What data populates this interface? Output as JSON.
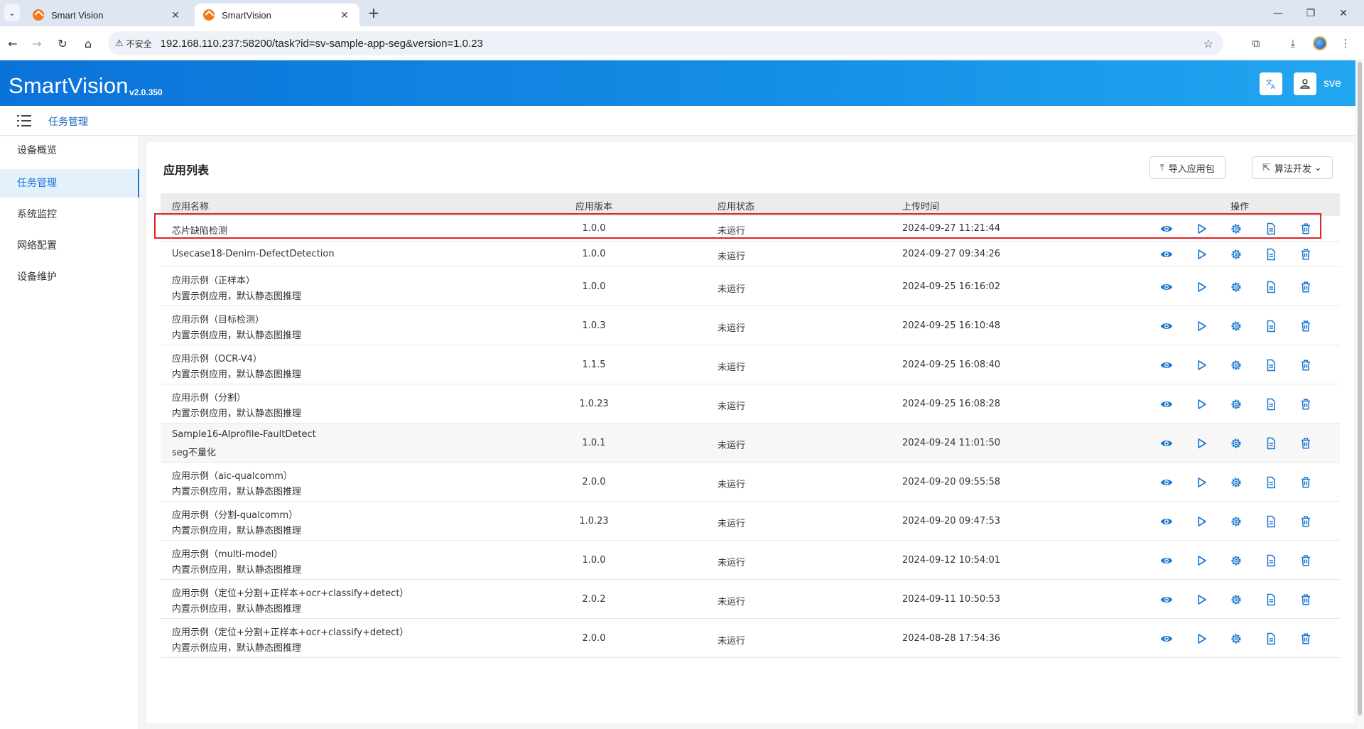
{
  "browser": {
    "tabs": [
      {
        "title": "Smart Vision",
        "active": false
      },
      {
        "title": "SmartVision",
        "active": true
      }
    ],
    "insecure_label": "不安全",
    "url": "192.168.110.237:58200/task?id=sv-sample-app-seg&version=1.0.23"
  },
  "header": {
    "brand": "SmartVision",
    "version": "v2.0.350",
    "user": "sve",
    "colors": {
      "gradient_start": "#0b72d9",
      "gradient_end": "#23a6f0"
    }
  },
  "breadcrumb": "任务管理",
  "sidebar": {
    "items": [
      {
        "label": "设备概览",
        "active": false
      },
      {
        "label": "任务管理",
        "active": true
      },
      {
        "label": "系统监控",
        "active": false
      },
      {
        "label": "网络配置",
        "active": false
      },
      {
        "label": "设备维护",
        "active": false
      }
    ]
  },
  "main": {
    "title": "应用列表",
    "import_button": "导入应用包",
    "algo_button": "算法开发",
    "columns": [
      "应用名称",
      "应用版本",
      "应用状态",
      "上传时间",
      "操作"
    ],
    "rows": [
      {
        "name": "芯片缺陷检测",
        "desc": "",
        "version": "1.0.0",
        "status": "未运行",
        "time": "2024-09-27 11:21:44"
      },
      {
        "name": "Usecase18-Denim-DefectDetection",
        "desc": "",
        "version": "1.0.0",
        "status": "未运行",
        "time": "2024-09-27 09:34:26"
      },
      {
        "name": "应用示例（正样本）",
        "desc": "内置示例应用，默认静态图推理",
        "version": "1.0.0",
        "status": "未运行",
        "time": "2024-09-25 16:16:02"
      },
      {
        "name": "应用示例（目标检测）",
        "desc": "内置示例应用，默认静态图推理",
        "version": "1.0.3",
        "status": "未运行",
        "time": "2024-09-25 16:10:48"
      },
      {
        "name": "应用示例（OCR-V4）",
        "desc": "内置示例应用，默认静态图推理",
        "version": "1.1.5",
        "status": "未运行",
        "time": "2024-09-25 16:08:40"
      },
      {
        "name": "应用示例（分割）",
        "desc": "内置示例应用，默认静态图推理",
        "version": "1.0.23",
        "status": "未运行",
        "time": "2024-09-25 16:08:28"
      },
      {
        "name": "Sample16-AIprofile-FaultDetect",
        "desc": "seg不量化",
        "version": "1.0.1",
        "status": "未运行",
        "time": "2024-09-24 11:01:50"
      },
      {
        "name": "应用示例（aic-qualcomm）",
        "desc": "内置示例应用，默认静态图推理",
        "version": "2.0.0",
        "status": "未运行",
        "time": "2024-09-20 09:55:58"
      },
      {
        "name": "应用示例（分割-qualcomm）",
        "desc": "内置示例应用，默认静态图推理",
        "version": "1.0.23",
        "status": "未运行",
        "time": "2024-09-20 09:47:53"
      },
      {
        "name": "应用示例（multi-model）",
        "desc": "内置示例应用，默认静态图推理",
        "version": "1.0.0",
        "status": "未运行",
        "time": "2024-09-12 10:54:01"
      },
      {
        "name": "应用示例（定位+分割+正样本+ocr+classify+detect）",
        "desc": "内置示例应用，默认静态图推理",
        "version": "2.0.2",
        "status": "未运行",
        "time": "2024-09-11 10:50:53"
      },
      {
        "name": "应用示例（定位+分割+正样本+ocr+classify+detect）",
        "desc": "内置示例应用，默认静态图推理",
        "version": "2.0.0",
        "status": "未运行",
        "time": "2024-08-28 17:54:36"
      }
    ],
    "action_icons": [
      "eye-icon",
      "play-icon",
      "settings-icon",
      "document-icon",
      "delete-icon"
    ],
    "accent_color": "#1976d2",
    "highlight_color": "#e02424"
  }
}
